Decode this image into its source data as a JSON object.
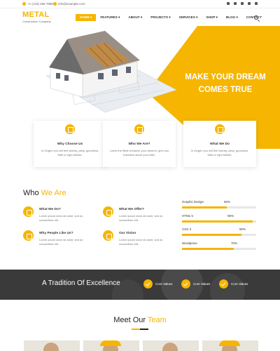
{
  "topbar": {
    "phone": "+1 (123) 456 7890",
    "email": "info@example.com"
  },
  "header": {
    "logo": "METAL",
    "logo_sub": "Construction Company",
    "nav": [
      "HOME ▾",
      "FEATURES ▾",
      "ABOUT ▾",
      "PROJECTS ▾",
      "SERVICES ▾",
      "SHOP ▾",
      "BLOG ▾",
      "CONTACT"
    ]
  },
  "hero": {
    "line1": "MAKE YOUR DREAM",
    "line2": "COMES TRUE"
  },
  "cards": [
    {
      "title": "Why Choose Us",
      "desc": "In Zeigen you will feel divinity, piety, goodness, faith or right beliefs."
    },
    {
      "title": "Who We Are?",
      "desc": "Learn the Bible enhance your wisdom, give you boldness about your faith."
    },
    {
      "title": "What We Do",
      "desc": "In Zeigen you will feel divinity, piety, goodness, faith or right beliefs."
    }
  ],
  "who": {
    "title_a": "Who",
    "title_b": "We Are",
    "features": [
      {
        "title": "What We Do?",
        "desc": "Lorem ipsum dolor sit amet, sed do consectetur elit."
      },
      {
        "title": "What We Offer?",
        "desc": "Lorem ipsum dolor sit amet, sed do consectetur elit."
      },
      {
        "title": "Why People Like Us?",
        "desc": "Lorem ipsum dolor sit amet, sed do consectetur elit."
      },
      {
        "title": "Our Vision",
        "desc": "Lorem ipsum dolor sit amet, sed do consectetur elit."
      }
    ]
  },
  "skills": [
    {
      "label": "Graphic Design",
      "pct_label": "60%",
      "value": 0.6
    },
    {
      "label": "HTML 5",
      "pct_label": "95%",
      "value": 0.95
    },
    {
      "label": "CSS 3",
      "pct_label": "80%",
      "value": 0.8
    },
    {
      "label": "Wordpress",
      "pct_label": "70%",
      "value": 0.7
    }
  ],
  "band": {
    "title": "A Tradition Of Excellence",
    "values": [
      "Core Values",
      "Core Values",
      "Core Values"
    ]
  },
  "team": {
    "title_a": "Meet Our",
    "title_b": "Team"
  },
  "colors": {
    "accent": "#f5b500",
    "dark_band": "#3a3a3a"
  }
}
